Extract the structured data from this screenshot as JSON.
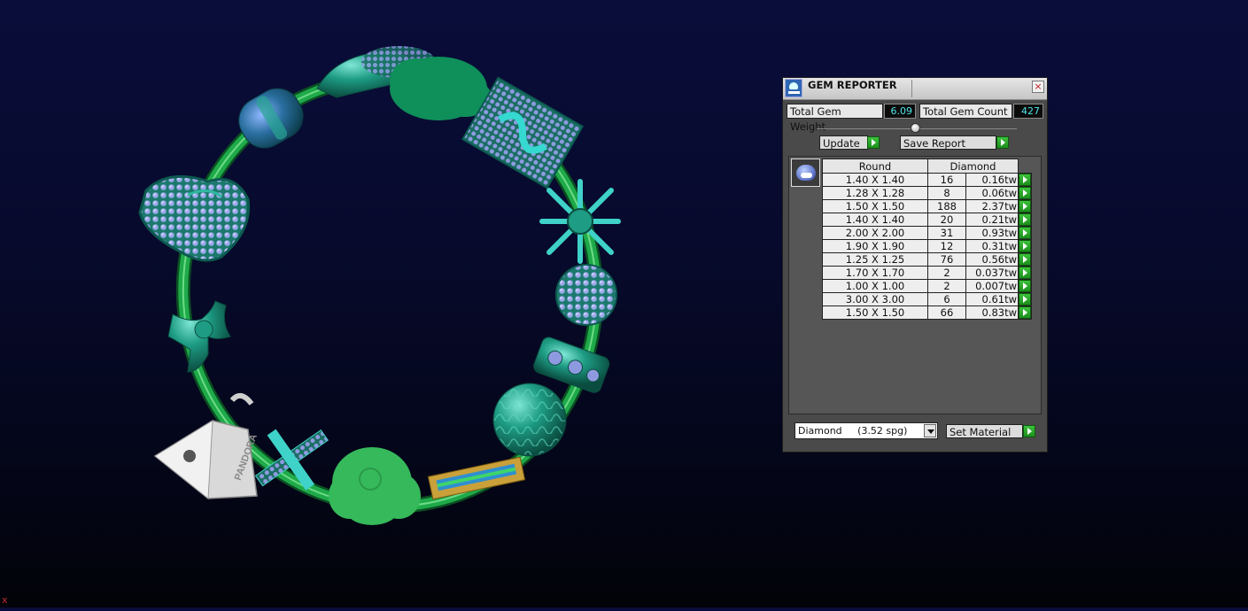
{
  "viewport": {
    "corner_marker": "x",
    "logo_text": "PANDORA"
  },
  "gem_reporter": {
    "title": "GEM REPORTER",
    "close_label": "×",
    "total_weight_label": "Total Gem Weight",
    "total_weight_value": "6.09",
    "total_count_label": "Total Gem Count",
    "total_count_value": "427",
    "update_label": "Update",
    "save_label": "Save Report",
    "table": {
      "headers": [
        "Round",
        "Diamond"
      ],
      "rows": [
        {
          "size": "1.40 X 1.40",
          "count": "16",
          "weight": "0.16tw"
        },
        {
          "size": "1.28 X 1.28",
          "count": "8",
          "weight": "0.06tw"
        },
        {
          "size": "1.50 X 1.50",
          "count": "188",
          "weight": "2.37tw"
        },
        {
          "size": "1.40 X 1.40",
          "count": "20",
          "weight": "0.21tw"
        },
        {
          "size": "2.00 X 2.00",
          "count": "31",
          "weight": "0.93tw"
        },
        {
          "size": "1.90 X 1.90",
          "count": "12",
          "weight": "0.31tw"
        },
        {
          "size": "1.25 X 1.25",
          "count": "76",
          "weight": "0.56tw"
        },
        {
          "size": "1.70 X 1.70",
          "count": "2",
          "weight": "0.037tw"
        },
        {
          "size": "1.00 X 1.00",
          "count": "2",
          "weight": "0.007tw"
        },
        {
          "size": "3.00 X 3.00",
          "count": "6",
          "weight": "0.61tw"
        },
        {
          "size": "1.50 X 1.50",
          "count": "66",
          "weight": "0.83tw"
        }
      ]
    },
    "material_select": "Diamond     (3.52 spg)",
    "set_material_label": "Set Material"
  },
  "colors": {
    "background_top": "#0a0d3a",
    "background_bottom": "#020308",
    "bracelet_green": "#1faa4a",
    "charm_teal": "#1e9c84",
    "gem_blue": "#8e9ae0",
    "value_cyan": "#4fe3e6",
    "go_green": "#2aa82a"
  }
}
